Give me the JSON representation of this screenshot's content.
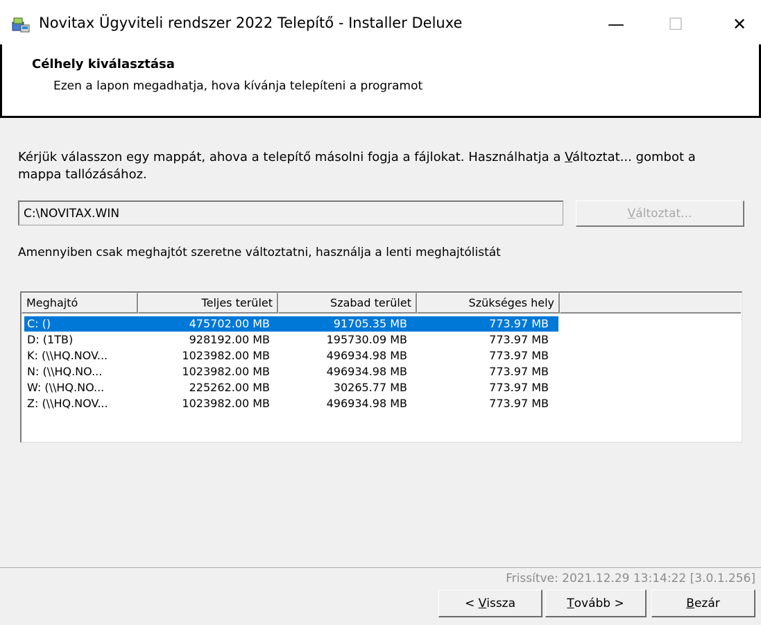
{
  "window": {
    "title": "Novitax Ügyviteli rendszer 2022 Telepítő - Installer Deluxe",
    "minimize_glyph": "—",
    "maximize_glyph": "☐",
    "close_glyph": "✕",
    "icon": "installer-icon"
  },
  "header": {
    "title": "Célhely kiválasztása",
    "subtitle": "Ezen a lapon megadhatja, hova kívánja telepíteni a programot"
  },
  "instruction": {
    "before": "Kérjük válasszon egy mappát, ahova a telepítő másolni fogja a fájlokat. Használhatja a ",
    "accel": "V",
    "after": "áltoztat... gombot a mappa tallózásához."
  },
  "path": {
    "value": "C:\\NOVITAX.WIN"
  },
  "change_button": {
    "accel": "V",
    "rest": "áltoztat..."
  },
  "drive_hint": "Amennyiben csak meghajtót szeretne változtatni, használja a lenti meghajtólistát",
  "drives": {
    "columns": [
      "Meghajtó",
      "Teljes terület",
      "Szabad terület",
      "Szükséges hely"
    ],
    "rows": [
      {
        "drive": "C: ()",
        "total": "475702.00 MB",
        "free": "91705.35 MB",
        "required": "773.97 MB",
        "selected": true
      },
      {
        "drive": "D: (1TB)",
        "total": "928192.00 MB",
        "free": "195730.09 MB",
        "required": "773.97 MB",
        "selected": false
      },
      {
        "drive": "K: (\\\\HQ.NOV...",
        "total": "1023982.00 MB",
        "free": "496934.98 MB",
        "required": "773.97 MB",
        "selected": false
      },
      {
        "drive": "N: (\\\\HQ.NO...",
        "total": "1023982.00 MB",
        "free": "496934.98 MB",
        "required": "773.97 MB",
        "selected": false
      },
      {
        "drive": "W: (\\\\HQ.NO...",
        "total": "225262.00 MB",
        "free": "30265.77 MB",
        "required": "773.97 MB",
        "selected": false
      },
      {
        "drive": "Z: (\\\\HQ.NOV...",
        "total": "1023982.00 MB",
        "free": "496934.98 MB",
        "required": "773.97 MB",
        "selected": false
      }
    ]
  },
  "footer": {
    "updated": "Frissítve: 2021.12.29  13:14:22  [3.0.1.256]",
    "back": {
      "prefix": "< ",
      "accel": "V",
      "rest": "issza"
    },
    "next": {
      "accel": "T",
      "rest": "ovább >"
    },
    "close": {
      "accel": "B",
      "rest": "ezár"
    }
  },
  "colors": {
    "selection": "#0078d7",
    "disabled_text": "#a8a8a8",
    "background": "#f0f0f0"
  }
}
